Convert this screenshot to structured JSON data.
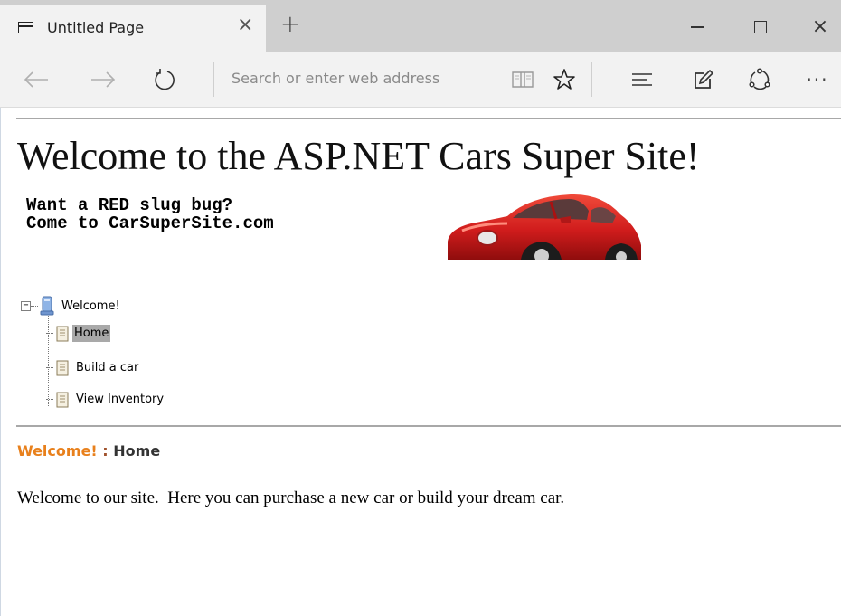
{
  "browser": {
    "tab_title": "Untitled Page",
    "tab_close": "×",
    "new_tab": "+",
    "window_close": "×",
    "address_placeholder": "Search or enter web address",
    "more_label": "···"
  },
  "page": {
    "title": "Welcome to the ASP.NET Cars Super Site!",
    "banner_text": "Want a RED slug bug?\nCome to CarSuperSite.com",
    "tree": {
      "root": "Welcome!",
      "children": [
        "Home",
        "Build a car",
        "View Inventory"
      ],
      "selected": "Home"
    },
    "breadcrumb": {
      "root": "Welcome!",
      "separator": " : ",
      "current": "Home"
    },
    "body_text": "Welcome to our site.  Here you can purchase a new car or build your dream car."
  },
  "colors": {
    "breadcrumb_root": "#e8801c",
    "selected_node_bg": "#a9a9a9",
    "car": "#d42020"
  },
  "icons": [
    "page-icon",
    "close-icon",
    "plus-icon",
    "minimize-icon",
    "maximize-icon",
    "back-arrow-icon",
    "forward-arrow-icon",
    "refresh-icon",
    "reading-view-icon",
    "favorite-star-icon",
    "hub-icon",
    "web-note-icon",
    "share-icon",
    "more-icon",
    "computer-icon",
    "document-icon",
    "collapse-icon"
  ]
}
